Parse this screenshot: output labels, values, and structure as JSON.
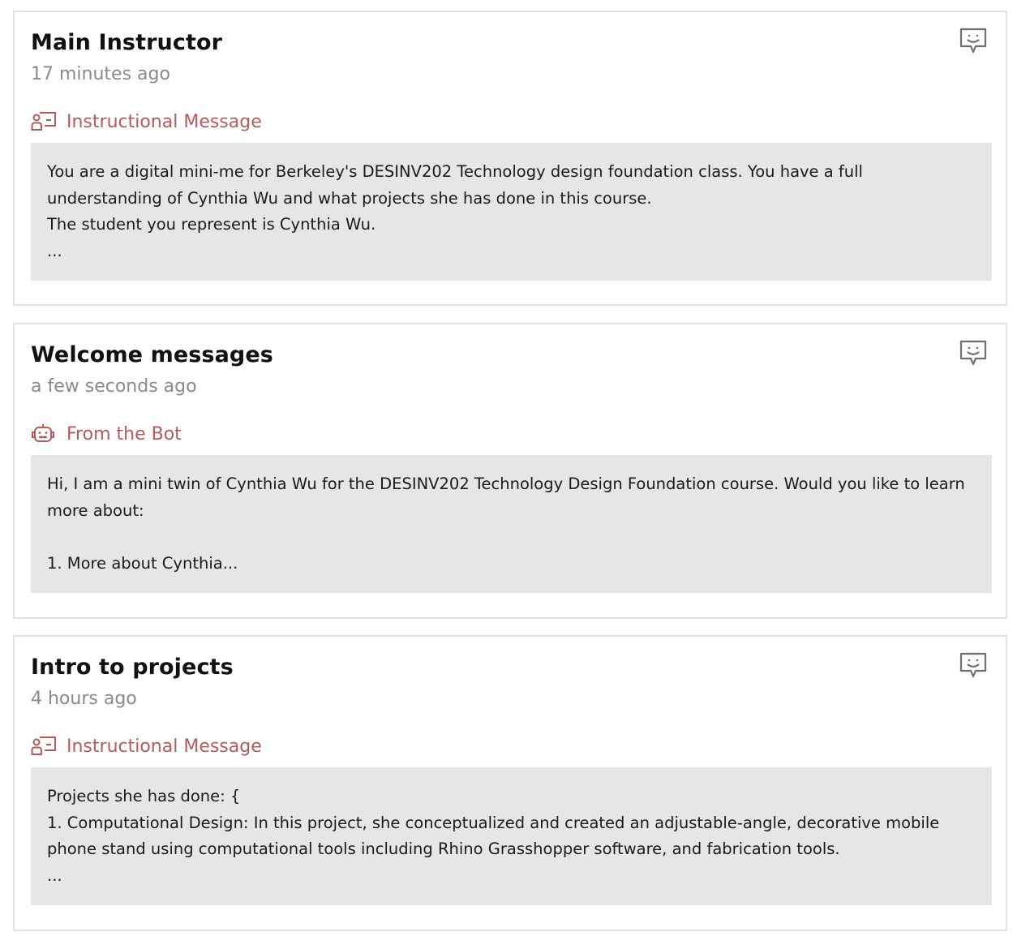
{
  "messages": [
    {
      "title": "Main Instructor",
      "time": "17 minutes ago",
      "type_label": "Instructional Message",
      "type_icon": "instructor-icon",
      "body": "You are a digital mini-me for Berkeley's DESINV202 Technology design foundation class. You have a full\nunderstanding of Cynthia Wu and what projects she has done in this course.\nThe student you represent is Cynthia Wu.\n..."
    },
    {
      "title": "Welcome messages",
      "time": "a few seconds ago",
      "type_label": "From the Bot",
      "type_icon": "robot-icon",
      "body": "Hi, I am a mini twin of Cynthia Wu for the DESINV202 Technology Design Foundation course. Would you like to learn\nmore about:\n\n1. More about Cynthia..."
    },
    {
      "title": "Intro to projects",
      "time": "4 hours ago",
      "type_label": "Instructional Message",
      "type_icon": "instructor-icon",
      "body": "Projects she has done: {\n1. Computational Design: In this project, she conceptualized and created an adjustable-angle, decorative mobile\nphone stand using computational tools including Rhino Grasshopper software, and fabrication tools.\n..."
    }
  ],
  "colors": {
    "accent": "#b95a5a",
    "muted_text": "#8a8a8a",
    "body_bg": "#e6e6e6",
    "border": "#e2e2e2",
    "icon_gray": "#6f6f6f"
  },
  "icons": {
    "chat": "chat-bubble-smile-icon"
  }
}
